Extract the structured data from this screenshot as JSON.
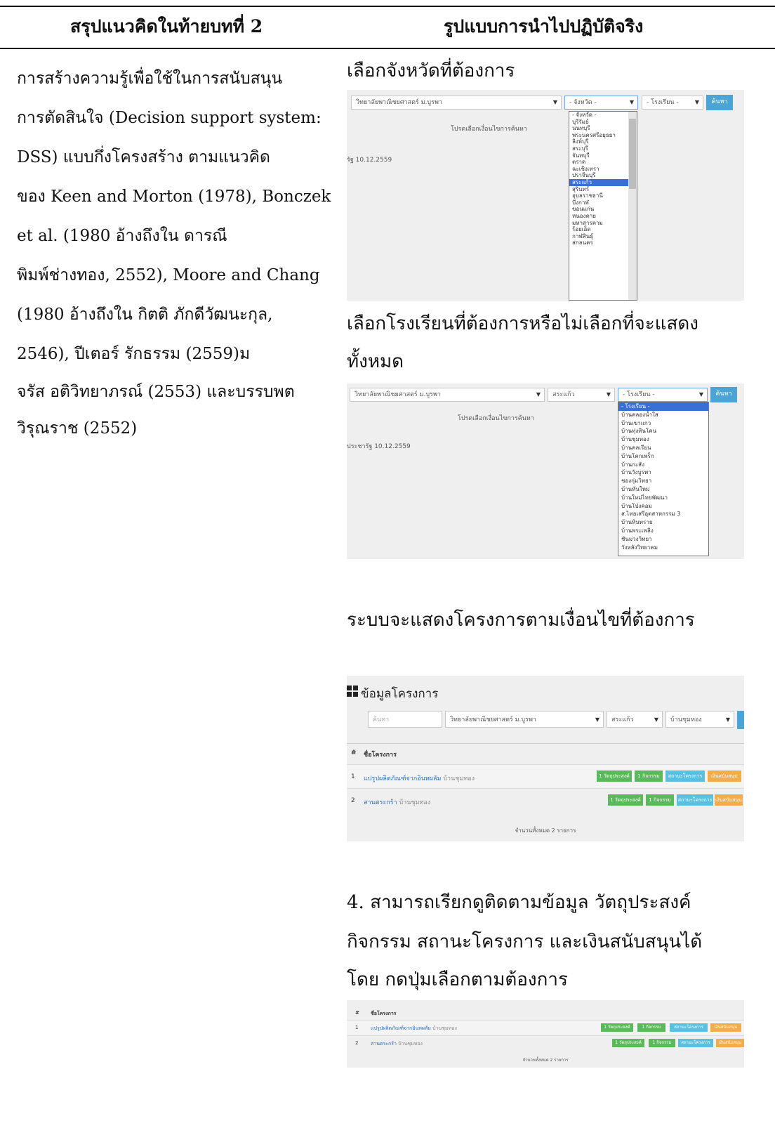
{
  "header": {
    "left": "สรุปแนวคิดในท้ายบทที่ 2",
    "right": "รูปแบบการนำไปปฏิบัติจริง"
  },
  "left_text": [
    "การสร้างความรู้เพื่อใช้ในการสนับสนุน",
    "การตัดสินใจ (Decision support system:",
    "DSS) แบบกึ่งโครงสร้าง ตามแนวคิด",
    "ของ Keen and Morton (1978), Bonczek",
    "et al. (1980 อ้างถึงใน ดารณี",
    "พิมพ์ช่างทอง, 2552), Moore and Chang",
    "(1980 อ้างถึงใน กิตติ ภักดีวัฒนะกุล,",
    "2546), ปีเตอร์ รักธรรม (2559)ม",
    "จรัส อติวิทยาภรณ์ (2553) และบรรบพต",
    "วิรุณราช (2552)"
  ],
  "captions": {
    "c1": "เลือกจังหวัดที่ต้องการ",
    "c2a": "เลือกโรงเรียนที่ต้องการหรือไม่เลือกที่จะแสดง",
    "c2b": "ทั้งหมด",
    "c3": "ระบบจะแสดงโครงการตามเงื่อนไขที่ต้องการ",
    "c4a": "4.  สามารถเรียกดูติดตามข้อมูล วัตถุประสงค์",
    "c4b": "กิจกรรม สถานะโครงการ และเงินสนับสนุนได้",
    "c4c": "โดย กดปุ่มเลือกตามต้องการ"
  },
  "shot1": {
    "college": "วิทยาลัยพาณิชยศาสตร์ ม.บูรพา",
    "province": "- จังหวัด -",
    "school": "- โรงเรียน -",
    "search": "ค้นหา",
    "prompt": "โปรดเลือกเงื่อนไขการค้นหา",
    "date": "รัฐ 10.12.2559",
    "provinces": [
      "- จังหวัด -",
      "บุรีรัมย์",
      "นนทบุรี",
      "พระนครศรีอยุธยา",
      "ลิงห์บุรี",
      "สระบุรี",
      "จันทบุรี",
      "ตราด",
      "ฉะเชิงเทรา",
      "ปราจีนบุรี",
      "สระแก้ว",
      "สุรินทร์",
      "อุบลราชธานี",
      "บึงกาฬ",
      "ขอนแก่น",
      "หนองคาย",
      "มหาสารคาม",
      "ร้อยเอ็ด",
      "กาฬสินธุ์",
      "สกลนคร"
    ]
  },
  "shot2": {
    "college": "วิทยาลัยพาณิชยศาสตร์ ม.บูรพา",
    "province": "สระแก้ว",
    "school": "- โรงเรียน -",
    "search": "ค้นหา",
    "prompt": "โปรดเลือกเงื่อนไขการค้นหา",
    "date": "ประชารัฐ 10.12.2559",
    "schools": [
      "- โรงเรียน -",
      "บ้านคลองน้ำใส",
      "บ้านเขาแกว",
      "บ้านทุ่งหินโคน",
      "บ้านชุมทอง",
      "บ้านคลเรียน",
      "บ้านโคกเพร็ก",
      "บ้านกะสัง",
      "บ้านวังบูรพา",
      "ชองกุ่มวิทยา",
      "บ้านหันใหม่",
      "บ้านใหม่ไทยพัฒนา",
      "บ้านโป่งคอม",
      "ส.ไทยเสรีอุตสาหกรรม 3",
      "บ้านหินทราย",
      "บ้านพระเพลิง",
      "ชันม่วงวิทยา",
      "วังหลังวิทยาคม"
    ]
  },
  "shot3": {
    "title": "ข้อมูลโครงการ",
    "search_placeholder": "ค้นหา",
    "college": "วิทยาลัยพาณิชยศาสตร์ ม.บูรพา",
    "province": "สระแก้ว",
    "school": "บ้านชุมทอง",
    "col_no": "#",
    "col_name": "ชื่อโครงการ",
    "rows": [
      {
        "no": "1",
        "name": "แปรูปผลิตภัณฑ์จากอินทผลัม",
        "school": "บ้านชุมทอง"
      },
      {
        "no": "2",
        "name": "สานตระกร้า",
        "school": "บ้านชุมทอง"
      }
    ],
    "tags": {
      "objective": "1 วัตถุประสงค์",
      "activity": "1 กิจกรรม",
      "status": "สถานะโครงการ",
      "money": "เงินสนับสนุน"
    },
    "total": "จำนวนทั้งหมด 2 รายการ"
  },
  "shot4": {
    "col_no": "#",
    "col_name": "ชื่อโครงการ",
    "rows": [
      {
        "no": "1",
        "name": "แปรูปผลิตภัณฑ์จากอินทผลัม",
        "school": "บ้านชุมทอง"
      },
      {
        "no": "2",
        "name": "สานตระกร้า",
        "school": "บ้านชุมทอง"
      }
    ],
    "tags": {
      "objective": "1 วัตถุประสงค์",
      "activity": "1 กิจกรรม",
      "status": "สถานะโครงการ",
      "money": "เงินสนับสนุน"
    },
    "total": "จำนวนทั้งหมด 2 รายการ"
  }
}
